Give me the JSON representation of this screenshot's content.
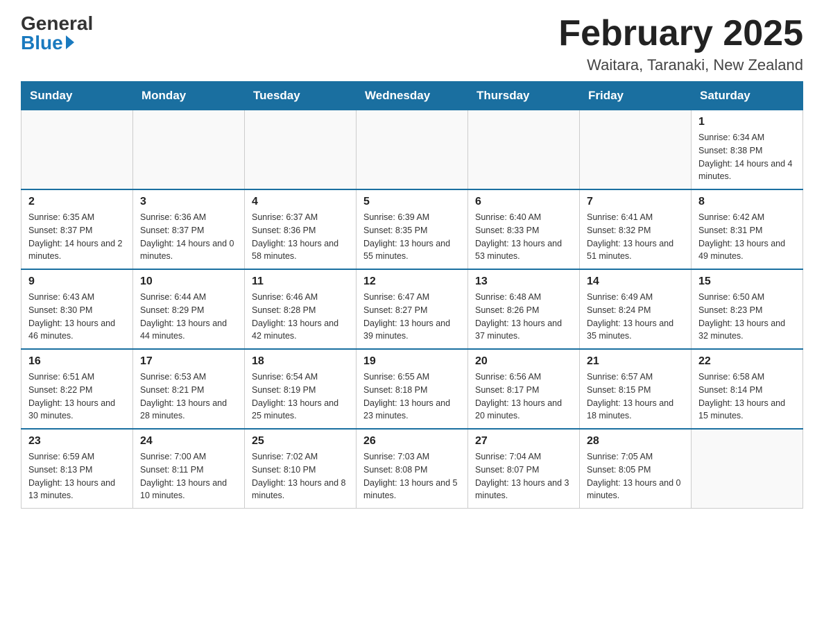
{
  "header": {
    "logo_general": "General",
    "logo_blue": "Blue",
    "main_title": "February 2025",
    "subtitle": "Waitara, Taranaki, New Zealand"
  },
  "weekdays": [
    "Sunday",
    "Monday",
    "Tuesday",
    "Wednesday",
    "Thursday",
    "Friday",
    "Saturday"
  ],
  "weeks": [
    {
      "days": [
        {
          "num": "",
          "info": ""
        },
        {
          "num": "",
          "info": ""
        },
        {
          "num": "",
          "info": ""
        },
        {
          "num": "",
          "info": ""
        },
        {
          "num": "",
          "info": ""
        },
        {
          "num": "",
          "info": ""
        },
        {
          "num": "1",
          "info": "Sunrise: 6:34 AM\nSunset: 8:38 PM\nDaylight: 14 hours and 4 minutes."
        }
      ]
    },
    {
      "days": [
        {
          "num": "2",
          "info": "Sunrise: 6:35 AM\nSunset: 8:37 PM\nDaylight: 14 hours and 2 minutes."
        },
        {
          "num": "3",
          "info": "Sunrise: 6:36 AM\nSunset: 8:37 PM\nDaylight: 14 hours and 0 minutes."
        },
        {
          "num": "4",
          "info": "Sunrise: 6:37 AM\nSunset: 8:36 PM\nDaylight: 13 hours and 58 minutes."
        },
        {
          "num": "5",
          "info": "Sunrise: 6:39 AM\nSunset: 8:35 PM\nDaylight: 13 hours and 55 minutes."
        },
        {
          "num": "6",
          "info": "Sunrise: 6:40 AM\nSunset: 8:33 PM\nDaylight: 13 hours and 53 minutes."
        },
        {
          "num": "7",
          "info": "Sunrise: 6:41 AM\nSunset: 8:32 PM\nDaylight: 13 hours and 51 minutes."
        },
        {
          "num": "8",
          "info": "Sunrise: 6:42 AM\nSunset: 8:31 PM\nDaylight: 13 hours and 49 minutes."
        }
      ]
    },
    {
      "days": [
        {
          "num": "9",
          "info": "Sunrise: 6:43 AM\nSunset: 8:30 PM\nDaylight: 13 hours and 46 minutes."
        },
        {
          "num": "10",
          "info": "Sunrise: 6:44 AM\nSunset: 8:29 PM\nDaylight: 13 hours and 44 minutes."
        },
        {
          "num": "11",
          "info": "Sunrise: 6:46 AM\nSunset: 8:28 PM\nDaylight: 13 hours and 42 minutes."
        },
        {
          "num": "12",
          "info": "Sunrise: 6:47 AM\nSunset: 8:27 PM\nDaylight: 13 hours and 39 minutes."
        },
        {
          "num": "13",
          "info": "Sunrise: 6:48 AM\nSunset: 8:26 PM\nDaylight: 13 hours and 37 minutes."
        },
        {
          "num": "14",
          "info": "Sunrise: 6:49 AM\nSunset: 8:24 PM\nDaylight: 13 hours and 35 minutes."
        },
        {
          "num": "15",
          "info": "Sunrise: 6:50 AM\nSunset: 8:23 PM\nDaylight: 13 hours and 32 minutes."
        }
      ]
    },
    {
      "days": [
        {
          "num": "16",
          "info": "Sunrise: 6:51 AM\nSunset: 8:22 PM\nDaylight: 13 hours and 30 minutes."
        },
        {
          "num": "17",
          "info": "Sunrise: 6:53 AM\nSunset: 8:21 PM\nDaylight: 13 hours and 28 minutes."
        },
        {
          "num": "18",
          "info": "Sunrise: 6:54 AM\nSunset: 8:19 PM\nDaylight: 13 hours and 25 minutes."
        },
        {
          "num": "19",
          "info": "Sunrise: 6:55 AM\nSunset: 8:18 PM\nDaylight: 13 hours and 23 minutes."
        },
        {
          "num": "20",
          "info": "Sunrise: 6:56 AM\nSunset: 8:17 PM\nDaylight: 13 hours and 20 minutes."
        },
        {
          "num": "21",
          "info": "Sunrise: 6:57 AM\nSunset: 8:15 PM\nDaylight: 13 hours and 18 minutes."
        },
        {
          "num": "22",
          "info": "Sunrise: 6:58 AM\nSunset: 8:14 PM\nDaylight: 13 hours and 15 minutes."
        }
      ]
    },
    {
      "days": [
        {
          "num": "23",
          "info": "Sunrise: 6:59 AM\nSunset: 8:13 PM\nDaylight: 13 hours and 13 minutes."
        },
        {
          "num": "24",
          "info": "Sunrise: 7:00 AM\nSunset: 8:11 PM\nDaylight: 13 hours and 10 minutes."
        },
        {
          "num": "25",
          "info": "Sunrise: 7:02 AM\nSunset: 8:10 PM\nDaylight: 13 hours and 8 minutes."
        },
        {
          "num": "26",
          "info": "Sunrise: 7:03 AM\nSunset: 8:08 PM\nDaylight: 13 hours and 5 minutes."
        },
        {
          "num": "27",
          "info": "Sunrise: 7:04 AM\nSunset: 8:07 PM\nDaylight: 13 hours and 3 minutes."
        },
        {
          "num": "28",
          "info": "Sunrise: 7:05 AM\nSunset: 8:05 PM\nDaylight: 13 hours and 0 minutes."
        },
        {
          "num": "",
          "info": ""
        }
      ]
    }
  ]
}
